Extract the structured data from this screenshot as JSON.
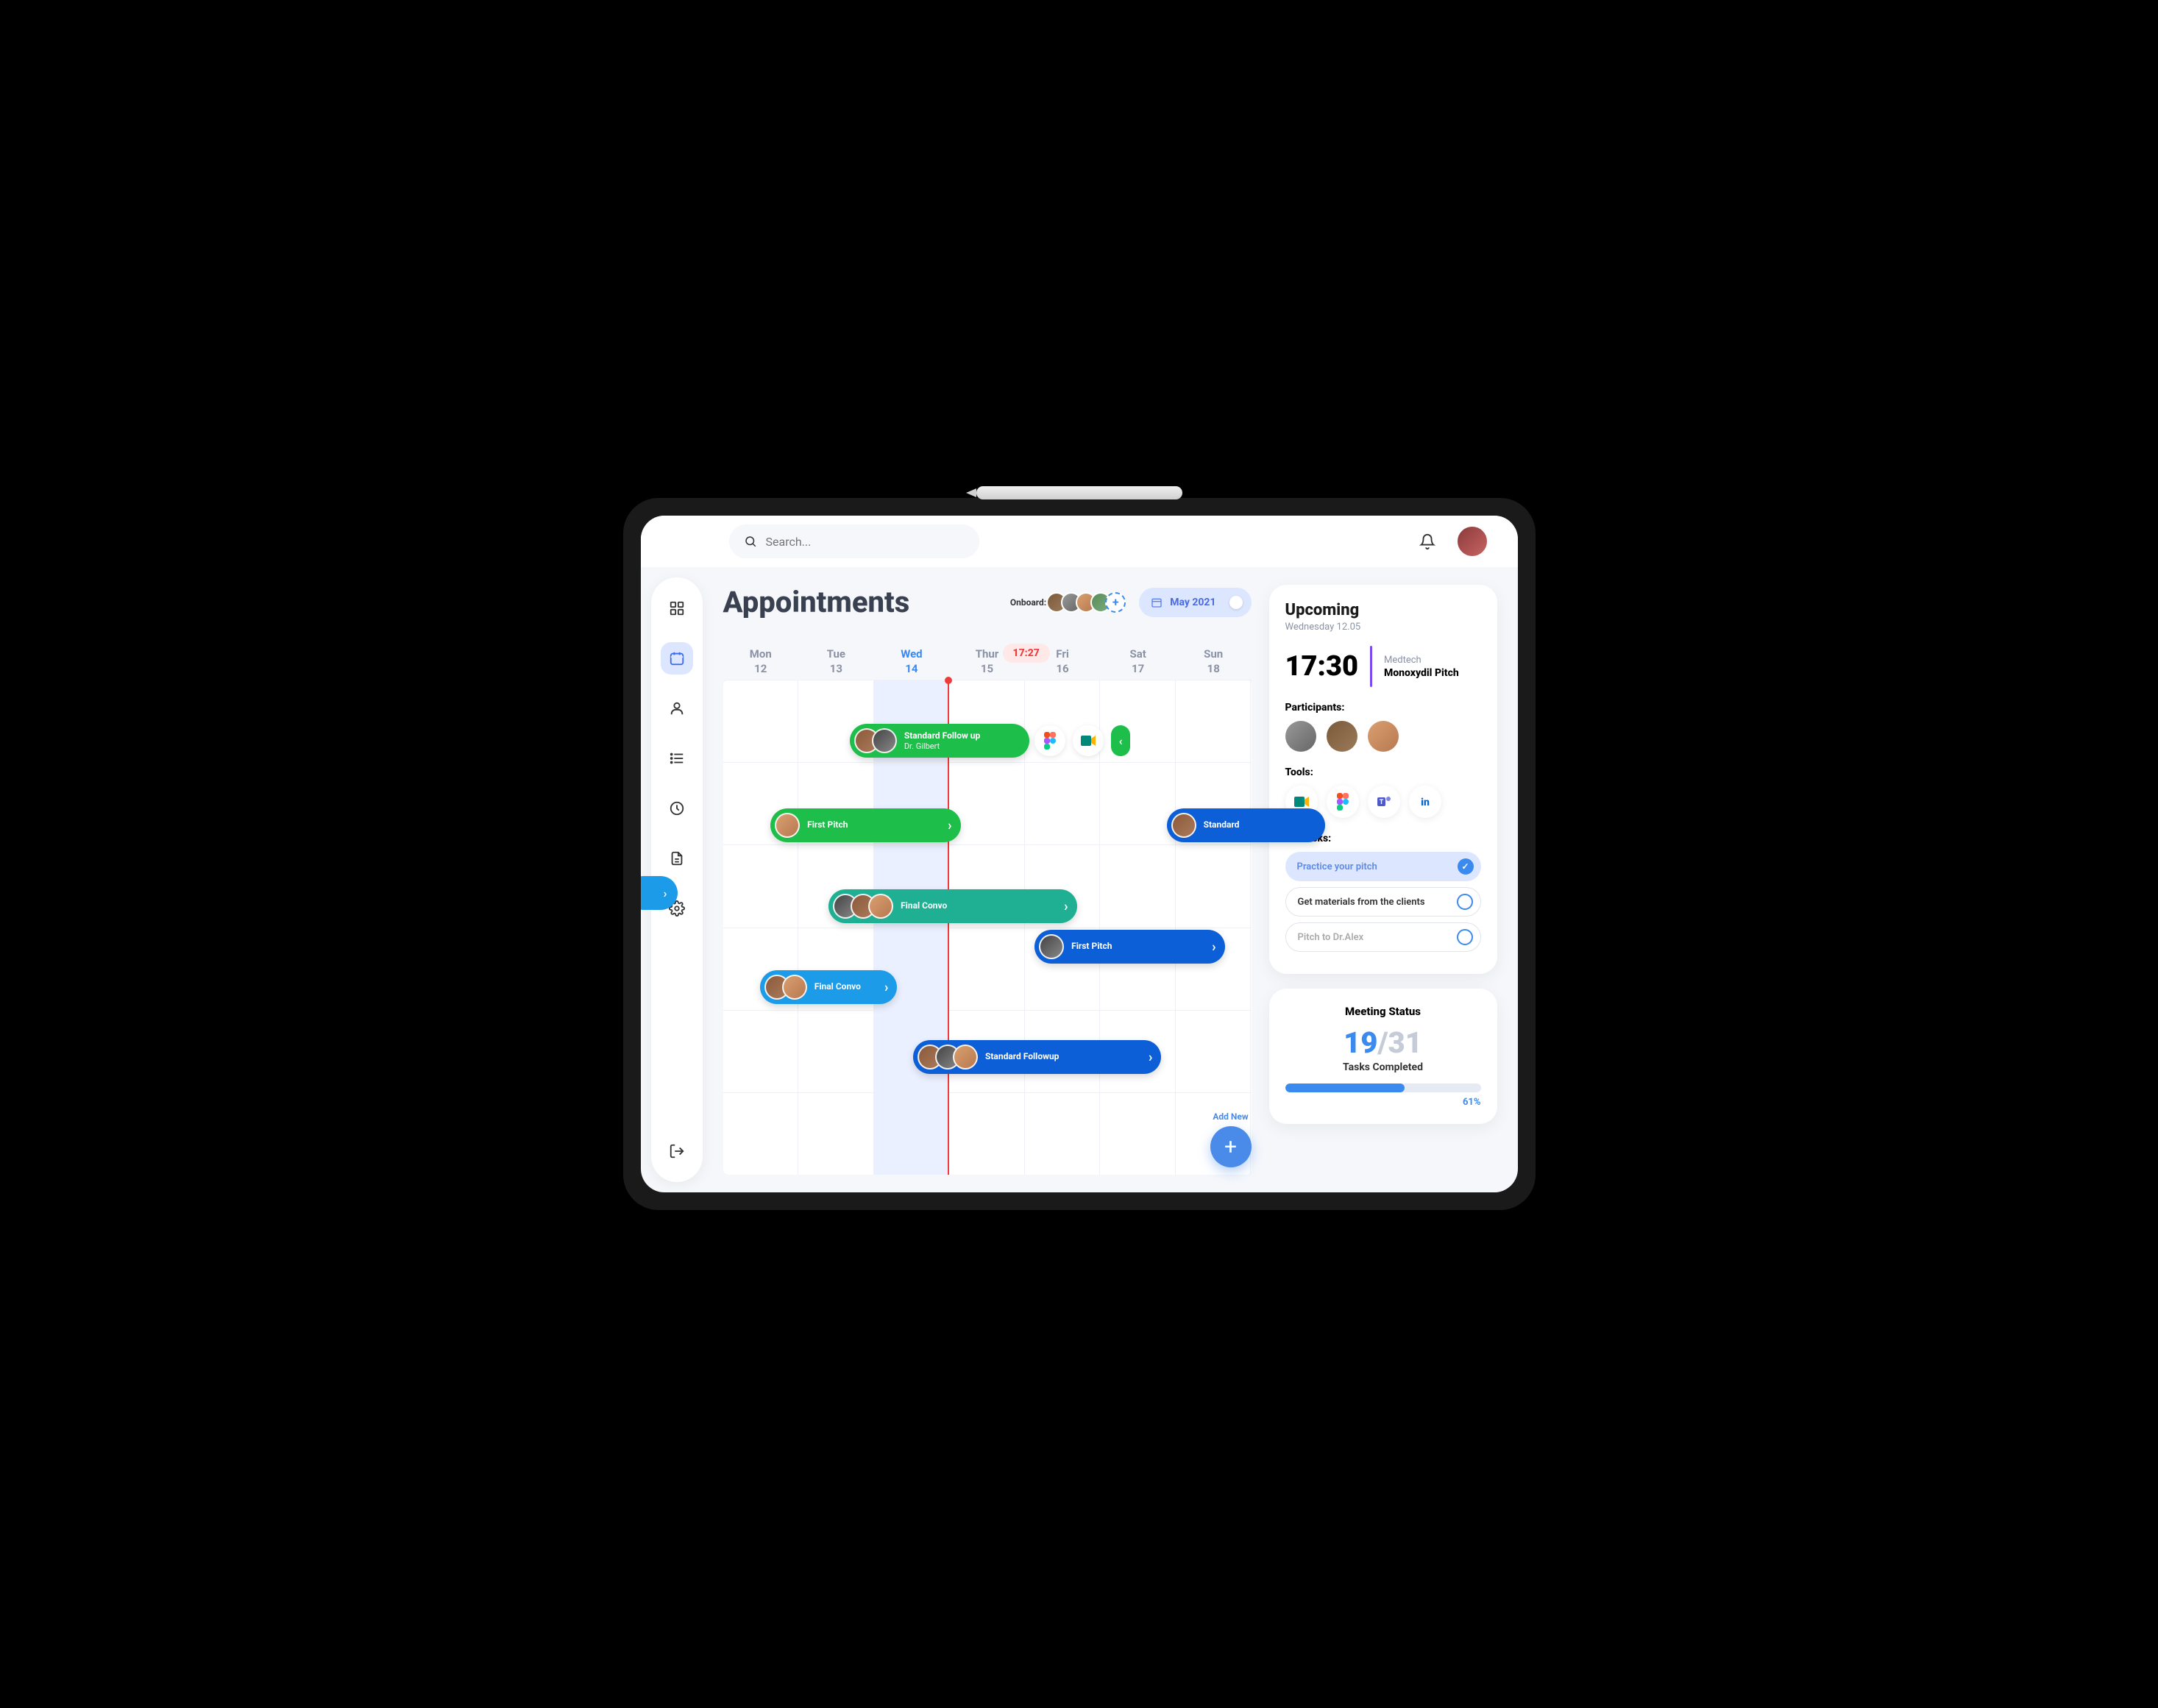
{
  "search": {
    "placeholder": "Search..."
  },
  "page": {
    "title": "Appointments",
    "onboard_label": "Onboard:",
    "month": "May 2021",
    "current_time": "17:27"
  },
  "days": [
    {
      "name": "Mon",
      "num": "12"
    },
    {
      "name": "Tue",
      "num": "13"
    },
    {
      "name": "Wed",
      "num": "14",
      "current": true
    },
    {
      "name": "Thur",
      "num": "15"
    },
    {
      "name": "Fri",
      "num": "16"
    },
    {
      "name": "Sat",
      "num": "17"
    },
    {
      "name": "Sun",
      "num": "18"
    }
  ],
  "events": {
    "e1": {
      "title": "Standard Follow up",
      "sub": "Dr. Gilbert"
    },
    "e2": {
      "title": "First Pitch"
    },
    "e3": {
      "title": "Final Convo"
    },
    "e4": {
      "title": "First Pitch"
    },
    "e5": {
      "title": "Final Convo"
    },
    "e6": {
      "title": "Standard Followup"
    },
    "e7": {
      "title": "Standard"
    }
  },
  "fab": {
    "label": "Add New"
  },
  "upcoming": {
    "title": "Upcoming",
    "date": "Wednesday 12.05",
    "time": "17:30",
    "category": "Medtech",
    "name": "Monoxydil Pitch",
    "participants_label": "Participants:",
    "tools_label": "Tools:",
    "subtasks_label": "Subtasks:",
    "subtasks": [
      "Practice your pitch",
      "Get materials from the clients",
      "Pitch to Dr.Alex"
    ]
  },
  "status": {
    "title": "Meeting Status",
    "done": "19",
    "sep": "/",
    "total": "31",
    "sub": "Tasks Completed",
    "pct": "61%",
    "pct_val": 61
  }
}
